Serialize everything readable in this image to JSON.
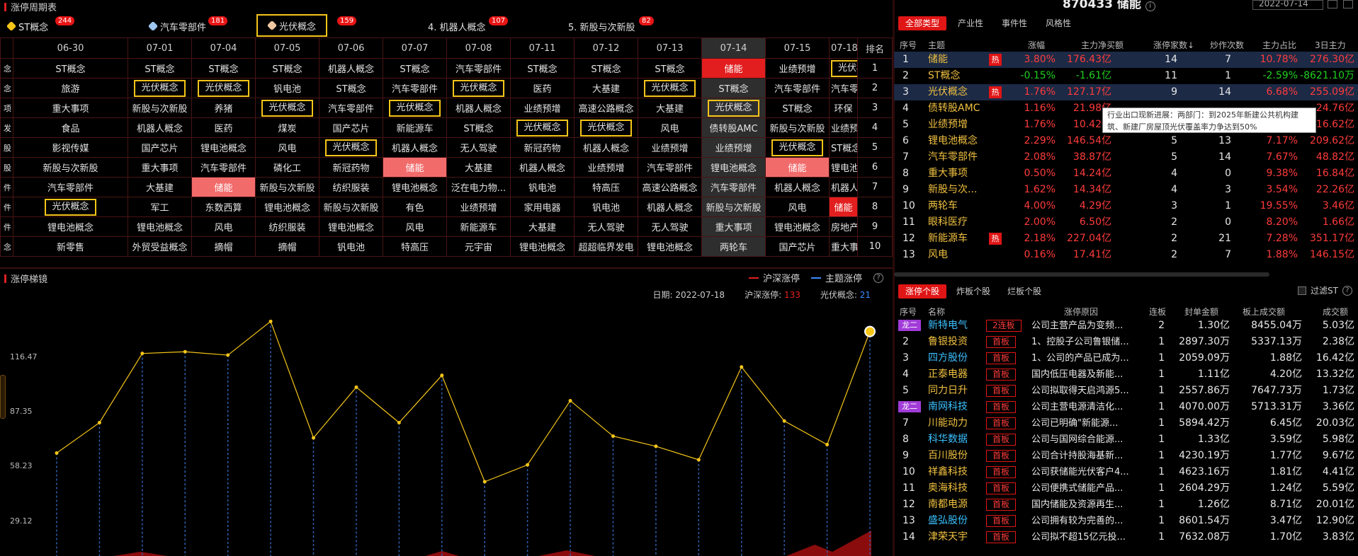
{
  "left_top": {
    "title": "涨停周期表",
    "tabs": [
      {
        "label": "ST概念",
        "badge": "244",
        "icon": "st-hexagon-icon",
        "icon_color": "#f5c518"
      },
      {
        "label": "汽车零部件",
        "badge": "181",
        "icon": "car-parts-hexagon-icon",
        "icon_color": "#9ec6f0"
      },
      {
        "label": "光伏概念",
        "badge": "159",
        "icon": "photovoltaic-hexagon-icon",
        "icon_color": "#f0c8a0"
      },
      {
        "label": "4. 机器人概念",
        "badge": "107",
        "icon": "",
        "icon_color": ""
      },
      {
        "label": "5. 新股与次新股",
        "badge": "82",
        "icon": "",
        "icon_color": ""
      }
    ],
    "dates": [
      "06-30",
      "07-01",
      "07-04",
      "07-05",
      "07-06",
      "07-07",
      "07-08",
      "07-11",
      "07-12",
      "07-13",
      "07-14",
      "07-15",
      "07-18"
    ],
    "rank_header": "排名",
    "row_labels": [
      "念",
      "念",
      "项",
      "发",
      "股",
      "股",
      "件",
      "件",
      "件",
      "念"
    ],
    "rows": [
      [
        "ST概念",
        "ST概念",
        "ST概念",
        "ST概念",
        "机器人概念",
        "ST概念",
        "汽车零部件",
        "ST概念",
        "ST概念",
        "ST概念",
        "储能",
        "业绩预增",
        "光伏概念"
      ],
      [
        "旅游",
        "光伏概念",
        "光伏概念",
        "钒电池",
        "ST概念",
        "汽车零部件",
        "光伏概念",
        "医药",
        "大基建",
        "光伏概念",
        "ST概念",
        "汽车零部件",
        "汽车零部件"
      ],
      [
        "重大事项",
        "新股与次新股",
        "养猪",
        "光伏概念",
        "汽车零部件",
        "光伏概念",
        "机器人概念",
        "业绩预增",
        "高速公路概念",
        "大基建",
        "光伏概念",
        "ST概念",
        "环保"
      ],
      [
        "食品",
        "机器人概念",
        "医药",
        "煤炭",
        "国产芯片",
        "新能源车",
        "ST概念",
        "光伏概念",
        "光伏概念",
        "风电",
        "债转股AMC",
        "新股与次新股",
        "业绩预增"
      ],
      [
        "影视传媒",
        "国产芯片",
        "锂电池概念",
        "风电",
        "光伏概念",
        "机器人概念",
        "无人驾驶",
        "新冠药物",
        "机器人概念",
        "业绩预增",
        "业绩预增",
        "光伏概念",
        "ST概念"
      ],
      [
        "新股与次新股",
        "重大事项",
        "汽车零部件",
        "磷化工",
        "新冠药物",
        "储能",
        "大基建",
        "机器人概念",
        "业绩预增",
        "汽车零部件",
        "锂电池概念",
        "储能",
        "锂电池概念"
      ],
      [
        "汽车零部件",
        "大基建",
        "储能",
        "新股与次新股",
        "纺织服装",
        "锂电池概念",
        "泛在电力物...",
        "钒电池",
        "特高压",
        "高速公路概念",
        "汽车零部件",
        "机器人概念",
        "机器人概念"
      ],
      [
        "光伏概念",
        "军工",
        "东数西算",
        "锂电池概念",
        "新股与次新股",
        "有色",
        "业绩预增",
        "家用电器",
        "钒电池",
        "机器人概念",
        "新股与次新股",
        "风电",
        "储能"
      ],
      [
        "锂电池概念",
        "锂电池概念",
        "风电",
        "纺织服装",
        "锂电池概念",
        "风电",
        "新能源车",
        "大基建",
        "无人驾驶",
        "无人驾驶",
        "重大事项",
        "锂电池概念",
        "房地产开发"
      ],
      [
        "新零售",
        "外贸受益概念",
        "摘帽",
        "摘帽",
        "钒电池",
        "特高压",
        "元宇宙",
        "锂电池概念",
        "超超临界发电",
        "锂电池概念",
        "两轮车",
        "国产芯片",
        "重大事项"
      ]
    ],
    "ranks": [
      "1",
      "2",
      "3",
      "4",
      "5",
      "6",
      "7",
      "8",
      "9",
      "10"
    ]
  },
  "left_bottom": {
    "title": "涨停梯镜",
    "legend": [
      {
        "label": "沪深涨停",
        "color": "#e02020"
      },
      {
        "label": "主题涨停",
        "color": "#3b8cff"
      }
    ],
    "info": {
      "date_label": "日期:",
      "date_value": "2022-07-18",
      "market_label": "沪深涨停:",
      "market_value": "133",
      "theme_label": "光伏概念:",
      "theme_value": "21"
    },
    "y_ticks": [
      "116.47",
      "87.35",
      "58.23",
      "29.12"
    ]
  },
  "chart_data": {
    "type": "line",
    "ylim": [
      0,
      145
    ],
    "series": [
      {
        "name": "沪深涨停",
        "color": "#8b0c0c",
        "values": [
          0,
          0,
          0,
          0,
          0,
          0,
          0,
          0,
          0,
          0,
          0,
          0,
          0,
          0,
          0,
          0,
          0,
          0,
          0,
          0
        ]
      },
      {
        "name": "主题涨停",
        "color": "#f5c518",
        "values": [
          61,
          79,
          120,
          121,
          119,
          139,
          70,
          100,
          79,
          107,
          44,
          54,
          92,
          71,
          65,
          57,
          112,
          80,
          66,
          133
        ]
      }
    ]
  },
  "right_top": {
    "stock_title": "870433 储能",
    "date": "2022-07-14",
    "tabs": [
      "全部类型",
      "产业性",
      "事件性",
      "风格性"
    ],
    "headers": [
      "序号",
      "主题",
      "涨幅",
      "主力净买额",
      "涨停家数↓",
      "炒作次数",
      "主力占比",
      "3日主力"
    ],
    "rows": [
      {
        "idx": "1",
        "name": "储能",
        "hot": "热",
        "chg": "3.80%",
        "net": "176.43亿",
        "limit": "14",
        "times": "7",
        "ratio": "10.78%",
        "d3": "276.30亿"
      },
      {
        "idx": "2",
        "name": "ST概念",
        "hot": "",
        "chg": "-0.15%",
        "net": "-1.61亿",
        "limit": "11",
        "times": "1",
        "ratio": "-2.59%",
        "d3": "-8621.10万"
      },
      {
        "idx": "3",
        "name": "光伏概念",
        "hot": "热",
        "chg": "1.76%",
        "net": "127.17亿",
        "limit": "9",
        "times": "14",
        "ratio": "6.68%",
        "d3": "255.09亿"
      },
      {
        "idx": "4",
        "name": "债转股AMC",
        "hot": "",
        "chg": "1.16%",
        "net": "21.98亿",
        "limit": "",
        "times": "",
        "ratio": "",
        "d3": "24.76亿"
      },
      {
        "idx": "5",
        "name": "业绩预增",
        "hot": "",
        "chg": "1.76%",
        "net": "10.42亿",
        "limit": "",
        "times": "",
        "ratio": "",
        "d3": "16.62亿"
      },
      {
        "idx": "6",
        "name": "锂电池概念",
        "hot": "",
        "chg": "2.29%",
        "net": "146.54亿",
        "limit": "5",
        "times": "13",
        "ratio": "7.17%",
        "d3": "209.62亿"
      },
      {
        "idx": "7",
        "name": "汽车零部件",
        "hot": "",
        "chg": "2.08%",
        "net": "38.87亿",
        "limit": "5",
        "times": "14",
        "ratio": "7.67%",
        "d3": "48.82亿"
      },
      {
        "idx": "8",
        "name": "重大事项",
        "hot": "",
        "chg": "0.50%",
        "net": "14.24亿",
        "limit": "4",
        "times": "0",
        "ratio": "9.38%",
        "d3": "16.84亿"
      },
      {
        "idx": "9",
        "name": "新股与次...",
        "hot": "",
        "chg": "1.62%",
        "net": "14.34亿",
        "limit": "4",
        "times": "3",
        "ratio": "3.54%",
        "d3": "22.26亿"
      },
      {
        "idx": "10",
        "name": "两轮车",
        "hot": "",
        "chg": "4.00%",
        "net": "4.29亿",
        "limit": "3",
        "times": "1",
        "ratio": "19.55%",
        "d3": "3.46亿"
      },
      {
        "idx": "11",
        "name": "眼科医疗",
        "hot": "",
        "chg": "2.00%",
        "net": "6.50亿",
        "limit": "2",
        "times": "0",
        "ratio": "8.20%",
        "d3": "1.66亿"
      },
      {
        "idx": "12",
        "name": "新能源车",
        "hot": "热",
        "chg": "2.18%",
        "net": "227.04亿",
        "limit": "2",
        "times": "21",
        "ratio": "7.28%",
        "d3": "351.17亿"
      },
      {
        "idx": "13",
        "name": "风电",
        "hot": "",
        "chg": "0.16%",
        "net": "17.41亿",
        "limit": "2",
        "times": "7",
        "ratio": "1.88%",
        "d3": "146.15亿"
      }
    ],
    "tooltip": "行业出口现新进展：两部门：到2025年新建公共机构建筑、新建厂房屋顶光伏覆盖率力争达到50%"
  },
  "right_bottom": {
    "tabs": [
      "涨停个股",
      "炸板个股",
      "烂板个股"
    ],
    "filter_label": "过滤ST",
    "headers": [
      "序号",
      "名称",
      "涨停原因",
      "连板",
      "封单金额",
      "板上成交额",
      "成交额"
    ],
    "rows": [
      {
        "idx": "龙二",
        "dragon": true,
        "name": "新特电气",
        "board": "2连板",
        "reason": "公司主营产品为变频...",
        "lb": "2",
        "seal": "1.30亿",
        "onboard": "8455.04万",
        "amount": "5.03亿"
      },
      {
        "idx": "2",
        "dragon": false,
        "name": "鲁银投资",
        "board": "首板",
        "reason": "1、控股子公司鲁银储...",
        "lb": "1",
        "seal": "2897.30万",
        "onboard": "5337.13万",
        "amount": "2.38亿"
      },
      {
        "idx": "3",
        "dragon": false,
        "name": "四方股份",
        "board": "首板",
        "reason": "1、公司的产品已成为...",
        "lb": "1",
        "seal": "2059.09万",
        "onboard": "1.88亿",
        "amount": "16.42亿"
      },
      {
        "idx": "4",
        "dragon": false,
        "name": "正泰电器",
        "board": "首板",
        "reason": "国内低压电器及新能...",
        "lb": "1",
        "seal": "1.11亿",
        "onboard": "4.20亿",
        "amount": "13.32亿"
      },
      {
        "idx": "5",
        "dragon": false,
        "name": "同力日升",
        "board": "首板",
        "reason": "公司拟取得天启鸿源5...",
        "lb": "1",
        "seal": "2557.86万",
        "onboard": "7647.73万",
        "amount": "1.73亿"
      },
      {
        "idx": "龙二",
        "dragon": true,
        "name": "南网科技",
        "board": "首板",
        "reason": "公司主营电源清洁化...",
        "lb": "1",
        "seal": "4070.00万",
        "onboard": "5713.31万",
        "amount": "3.36亿"
      },
      {
        "idx": "7",
        "dragon": false,
        "name": "川能动力",
        "board": "首板",
        "reason": "公司已明确\"新能源...",
        "lb": "1",
        "seal": "5894.42万",
        "onboard": "6.45亿",
        "amount": "20.03亿"
      },
      {
        "idx": "8",
        "dragon": false,
        "name": "科华数据",
        "board": "首板",
        "reason": "公司与国网综合能源...",
        "lb": "1",
        "seal": "1.33亿",
        "onboard": "3.59亿",
        "amount": "5.98亿"
      },
      {
        "idx": "9",
        "dragon": false,
        "name": "百川股份",
        "board": "首板",
        "reason": "公司合计持股海基新...",
        "lb": "1",
        "seal": "4230.19万",
        "onboard": "1.77亿",
        "amount": "9.67亿"
      },
      {
        "idx": "10",
        "dragon": false,
        "name": "祥鑫科技",
        "board": "首板",
        "reason": "公司获储能光伏客户4...",
        "lb": "1",
        "seal": "4623.16万",
        "onboard": "1.81亿",
        "amount": "4.41亿"
      },
      {
        "idx": "11",
        "dragon": false,
        "name": "奥海科技",
        "board": "首板",
        "reason": "公司便携式储能产品...",
        "lb": "1",
        "seal": "2604.29万",
        "onboard": "1.24亿",
        "amount": "5.59亿"
      },
      {
        "idx": "12",
        "dragon": false,
        "name": "南都电源",
        "board": "首板",
        "reason": "国内储能及资源再生...",
        "lb": "1",
        "seal": "1.26亿",
        "onboard": "8.71亿",
        "amount": "20.01亿"
      },
      {
        "idx": "13",
        "dragon": false,
        "name": "盛弘股份",
        "board": "首板",
        "reason": "公司拥有较为完善的...",
        "lb": "1",
        "seal": "8601.54万",
        "onboard": "3.47亿",
        "amount": "12.90亿"
      },
      {
        "idx": "14",
        "dragon": false,
        "name": "津荣天宇",
        "board": "首板",
        "reason": "公司拟不超15亿元投...",
        "lb": "1",
        "seal": "7632.08万",
        "onboard": "1.70亿",
        "amount": "3.83亿"
      }
    ]
  }
}
